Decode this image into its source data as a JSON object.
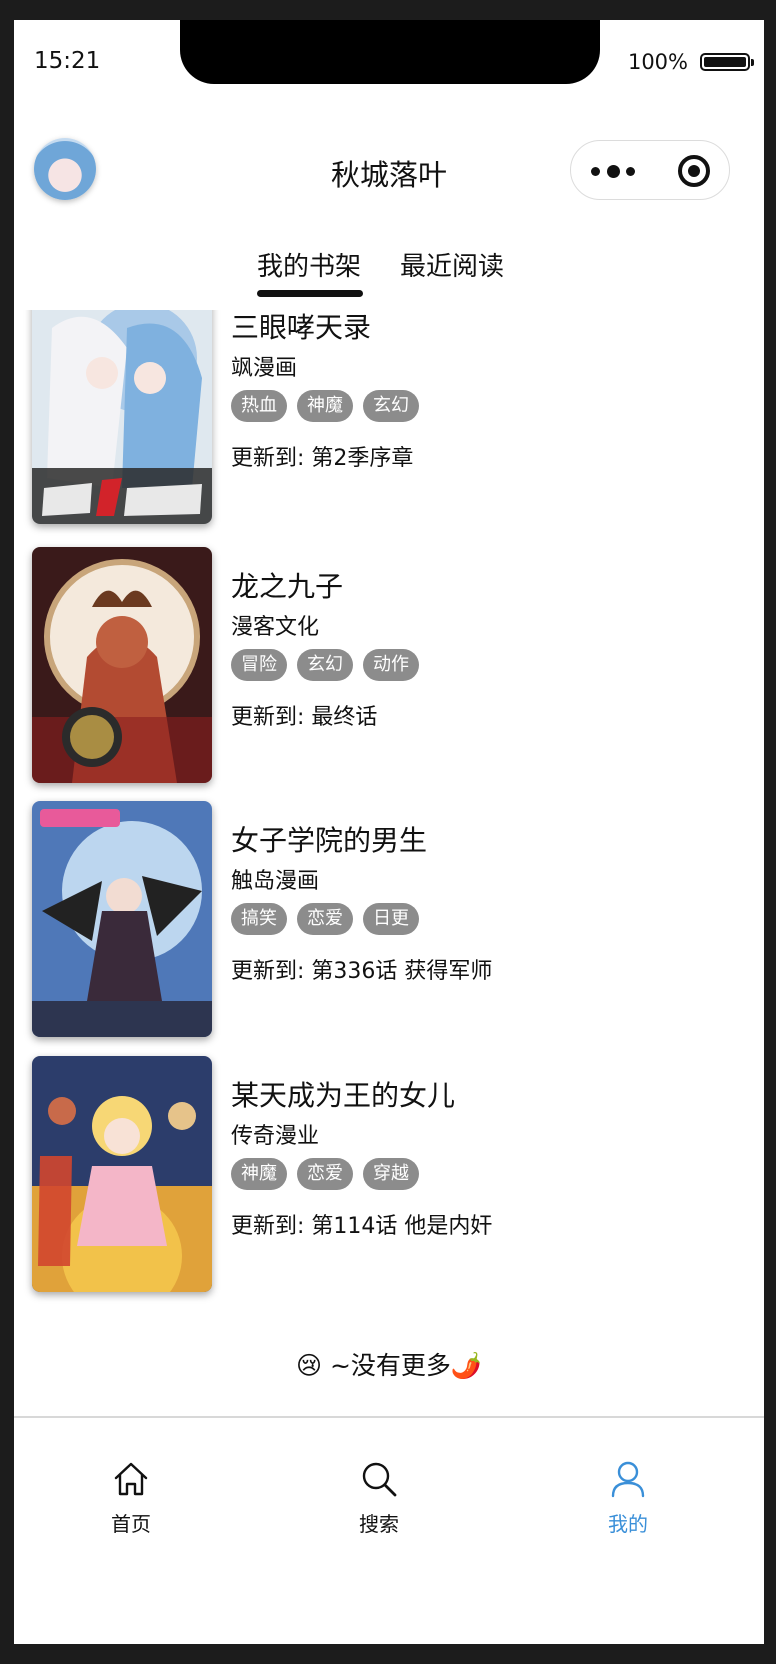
{
  "status_bar": {
    "time": "15:21",
    "battery": "100%"
  },
  "header": {
    "title": "秋城落叶"
  },
  "tabs": [
    {
      "label": "我的书架",
      "active": true
    },
    {
      "label": "最近阅读",
      "active": false
    }
  ],
  "books": [
    {
      "title": "三眼哮天录",
      "author": "飒漫画",
      "tags": [
        "热血",
        "神魔",
        "玄幻"
      ],
      "update": "更新到: 第2季序章"
    },
    {
      "title": "龙之九子",
      "author": "漫客文化",
      "tags": [
        "冒险",
        "玄幻",
        "动作"
      ],
      "update": "更新到: 最终话"
    },
    {
      "title": "女子学院的男生",
      "author": "触岛漫画",
      "tags": [
        "搞笑",
        "恋爱",
        "日更"
      ],
      "update": "更新到: 第336话 获得军师"
    },
    {
      "title": "某天成为王的女儿",
      "author": "传奇漫业",
      "tags": [
        "神魔",
        "恋爱",
        "穿越"
      ],
      "update": "更新到: 第114话 他是内奸"
    }
  ],
  "list_footer": "😢 ~没有更多🌶️",
  "bottom_nav": [
    {
      "label": "首页",
      "icon": "home-icon",
      "active": false
    },
    {
      "label": "搜索",
      "icon": "search-icon",
      "active": false
    },
    {
      "label": "我的",
      "icon": "user-icon",
      "active": true
    }
  ],
  "colors": {
    "active_nav": "#3a8fd8",
    "tag_bg": "#8c8c8c"
  }
}
